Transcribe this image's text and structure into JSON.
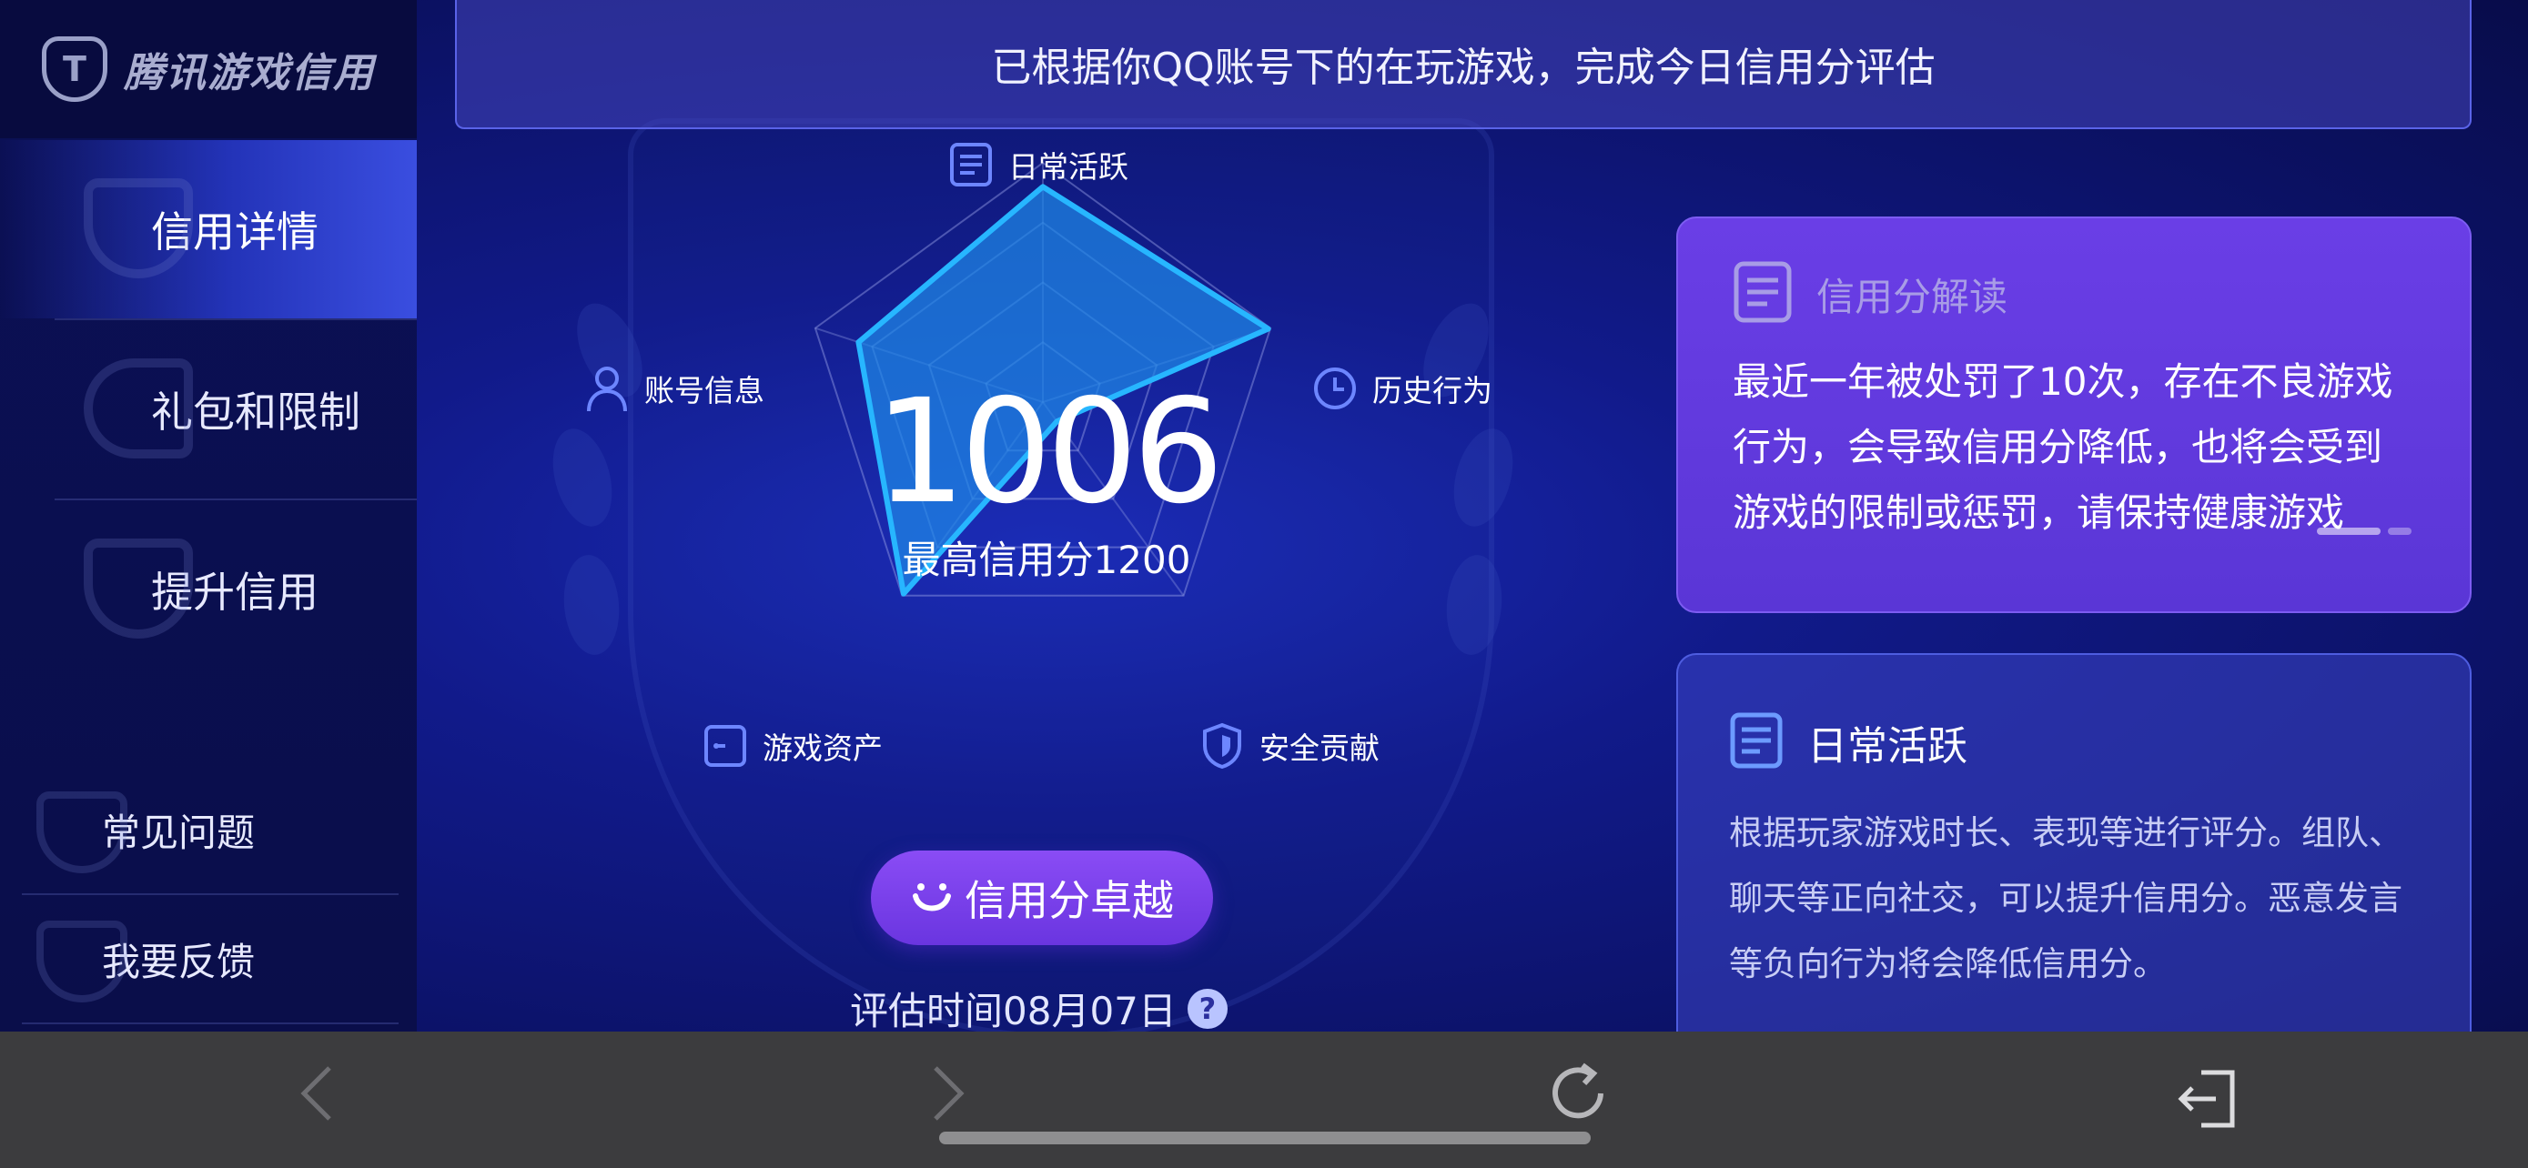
{
  "brand": {
    "logo_glyph": "T",
    "name": "腾讯游戏信用"
  },
  "sidebar": {
    "items": [
      {
        "label": "信用详情",
        "active": true
      },
      {
        "label": "礼包和限制",
        "active": false
      },
      {
        "label": "提升信用",
        "active": false
      }
    ],
    "footer_items": [
      {
        "label": "常见问题"
      },
      {
        "label": "我要反馈"
      }
    ]
  },
  "banner": {
    "text": "已根据你QQ账号下的在玩游戏，完成今日信用分评估"
  },
  "radar": {
    "score": "1006",
    "max_text": "最高信用分1200",
    "axes": [
      {
        "label": "日常活跃",
        "icon": "document-icon",
        "value": 0.9
      },
      {
        "label": "历史行为",
        "icon": "clock-icon",
        "value": 0.99
      },
      {
        "label": "安全贡献",
        "icon": "shield-icon",
        "value": 0.1
      },
      {
        "label": "游戏资产",
        "icon": "wallet-icon",
        "value": 0.99
      },
      {
        "label": "账号信息",
        "icon": "user-icon",
        "value": 0.81
      }
    ],
    "fill_color": "#1f88e8",
    "stroke_color": "#27b6ff"
  },
  "rank": {
    "label": "信用分卓越"
  },
  "evaluation": {
    "text": "评估时间08月07日",
    "help_glyph": "?"
  },
  "interpretation_card": {
    "title": "信用分解读",
    "body": "最近一年被处罚了10次，存在不良游戏行为，会导致信用分降低，也将会受到游戏的限制或惩罚，请保持健康游戏"
  },
  "dimension_card": {
    "title": "日常活跃",
    "body": "根据玩家游戏时长、表现等进行评分。组队、聊天等正向社交，可以提升信用分。恶意发言等负向行为将会降低信用分。"
  },
  "bottom_bar": {
    "buttons": [
      "back-icon",
      "forward-icon",
      "refresh-icon",
      "exit-icon"
    ]
  }
}
